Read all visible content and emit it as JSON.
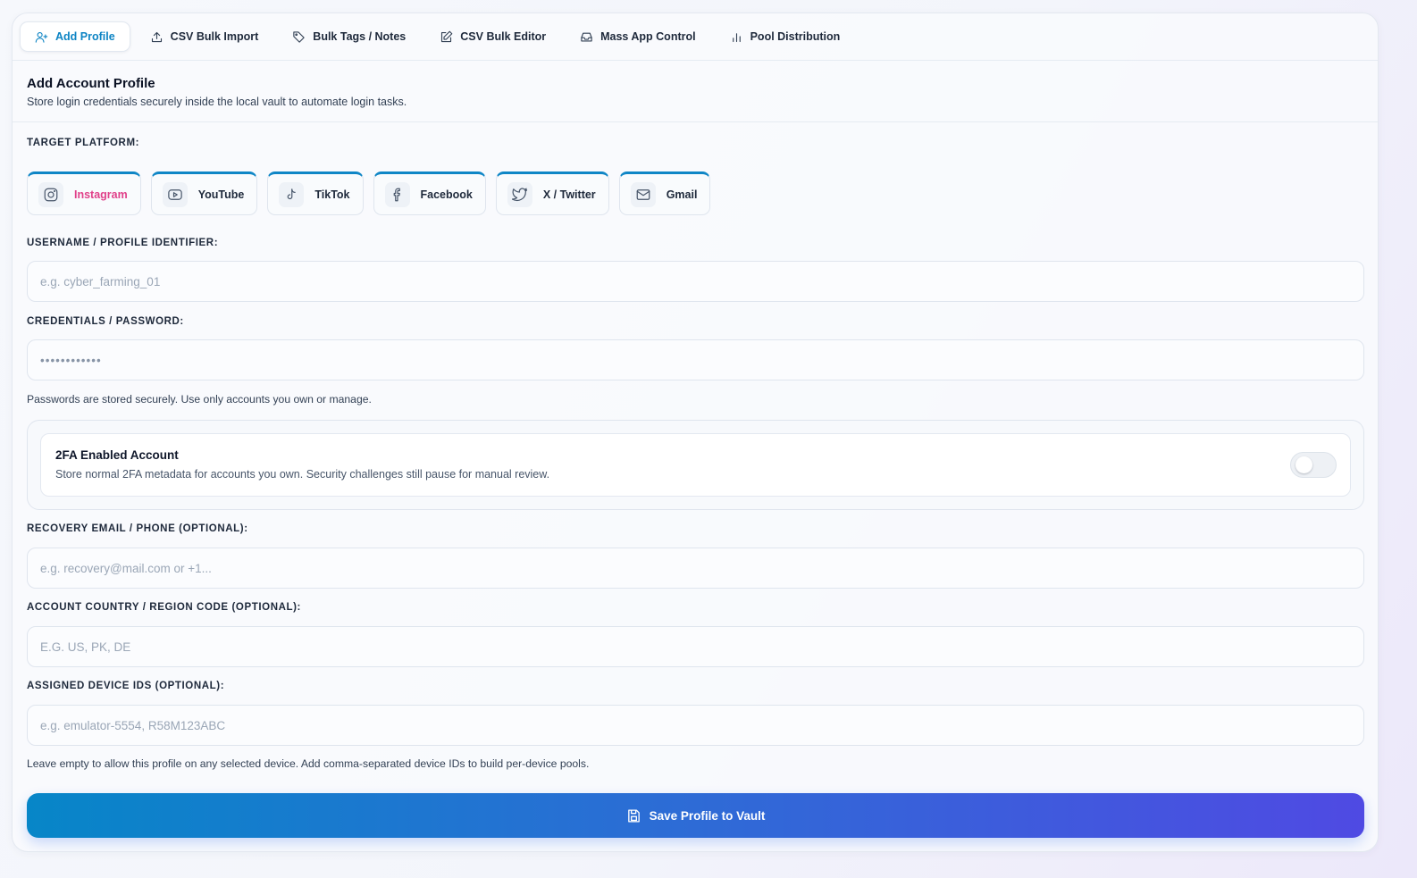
{
  "tabs": [
    {
      "label": "Add Profile",
      "icon": "user-plus-icon",
      "active": true
    },
    {
      "label": "CSV Bulk Import",
      "icon": "upload-icon"
    },
    {
      "label": "Bulk Tags / Notes",
      "icon": "tag-icon"
    },
    {
      "label": "CSV Bulk Editor",
      "icon": "edit-icon"
    },
    {
      "label": "Mass App Control",
      "icon": "inbox-icon"
    },
    {
      "label": "Pool Distribution",
      "icon": "bar-chart-icon"
    }
  ],
  "header": {
    "title": "Add Account Profile",
    "subtitle": "Store login credentials securely inside the local vault to automate login tasks."
  },
  "platform": {
    "label": "TARGET PLATFORM:",
    "options": [
      {
        "label": "Instagram",
        "icon": "instagram-icon",
        "selected": true
      },
      {
        "label": "YouTube",
        "icon": "youtube-icon"
      },
      {
        "label": "TikTok",
        "icon": "tiktok-icon"
      },
      {
        "label": "Facebook",
        "icon": "facebook-icon"
      },
      {
        "label": "X / Twitter",
        "icon": "twitter-icon"
      },
      {
        "label": "Gmail",
        "icon": "mail-icon"
      }
    ],
    "accent": "#0f86c6",
    "selected_color": "#e0418a"
  },
  "username": {
    "label": "USERNAME / PROFILE IDENTIFIER:",
    "placeholder": "e.g. cyber_farming_01",
    "value": ""
  },
  "password": {
    "label": "CREDENTIALS / PASSWORD:",
    "placeholder": "••••••••••••",
    "value": "",
    "hint": "Passwords are stored securely. Use only accounts you own or manage."
  },
  "twofa": {
    "title": "2FA Enabled Account",
    "description": "Store normal 2FA metadata for accounts you own. Security challenges still pause for manual review.",
    "enabled": false
  },
  "recovery": {
    "label": "RECOVERY EMAIL / PHONE (OPTIONAL):",
    "placeholder": "e.g. recovery@mail.com or +1...",
    "value": ""
  },
  "country": {
    "label": "ACCOUNT COUNTRY / REGION CODE (OPTIONAL):",
    "placeholder": "E.G. US, PK, DE",
    "value": ""
  },
  "devices": {
    "label": "ASSIGNED DEVICE IDS (OPTIONAL):",
    "placeholder": "e.g. emulator-5554, R58M123ABC",
    "value": "",
    "hint": "Leave empty to allow this profile on any selected device. Add comma-separated device IDs to build per-device pools."
  },
  "save_button": {
    "label": "Save Profile to Vault",
    "icon": "save-icon",
    "gradient": [
      "#0786c8",
      "#4f4ae3"
    ]
  }
}
